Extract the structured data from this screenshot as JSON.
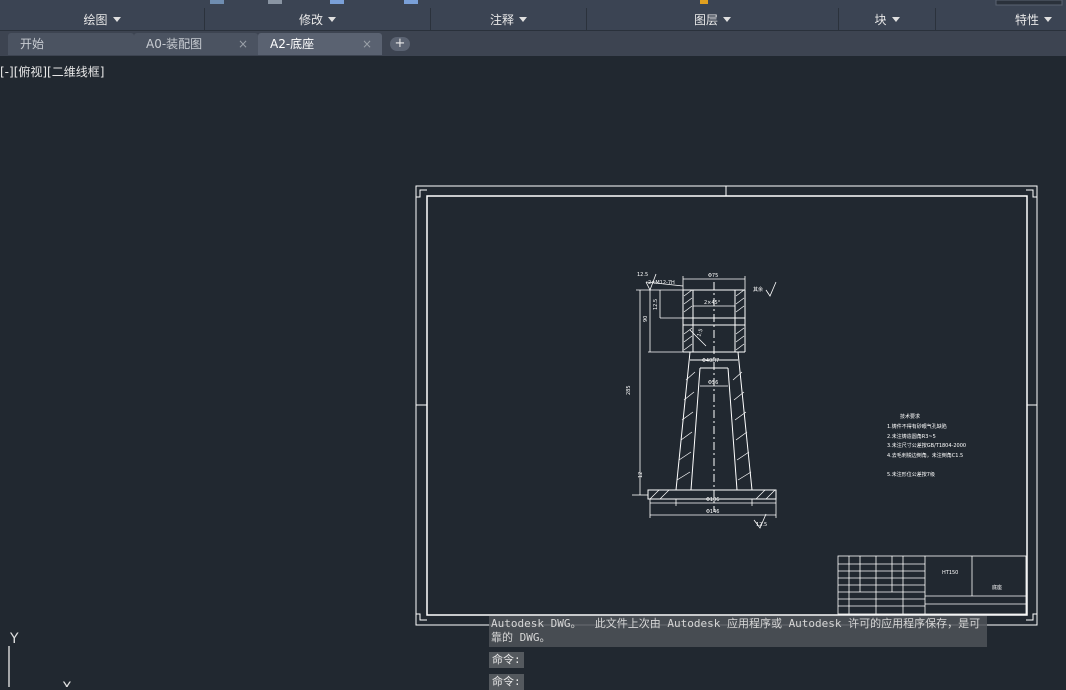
{
  "ribbon": {
    "panels": [
      {
        "label": "绘图"
      },
      {
        "label": "修改"
      },
      {
        "label": "注释"
      },
      {
        "label": "图层"
      },
      {
        "label": "块"
      },
      {
        "label": "特性"
      }
    ]
  },
  "tabs": [
    {
      "label": "开始"
    },
    {
      "label": "A0-装配图",
      "close": "×"
    },
    {
      "label": "A2-底座",
      "close": "×"
    }
  ],
  "new_tab": "+",
  "viewport_label": "[-][俯视][二维线框]",
  "drawing": {
    "roughness_top": "12.5",
    "chamfer_top": "2×M12-7H",
    "dim_top_width": "Φ75",
    "dim_chamfer": "2×45°",
    "dim_inner": "Φ40H7",
    "dim_mid": "Φ56",
    "dim_base_inner": "Φ106",
    "dim_base_outer": "Φ146",
    "dim_height_total": "285",
    "dim_height_left1": "90",
    "dim_height_left2": "12.5",
    "dim_height_small": "12",
    "dim_angle": "1:5",
    "roughness_right": "其余",
    "roughness_bottom": "12.5",
    "tech_title": "技术要求",
    "tech_lines": [
      "1.铸件不得有砂眼气孔缺陷",
      "2.未注铸造圆角R3~5",
      "3.未注尺寸公差按GB/T1804-2000",
      "4.去毛刺锐边倒角，未注倒角C1.5",
      "5.未注形位公差按7级"
    ],
    "title_material": "HT150",
    "title_name": "底座"
  },
  "command": {
    "history": "Autodesk DWG。  此文件上次由 Autodesk 应用程序或 Autodesk 许可的应用程序保存，是可靠的 DWG。",
    "line1": "命令:",
    "line2": "命令:"
  },
  "ucs": {
    "y_label": "Y",
    "x_label": "X"
  }
}
